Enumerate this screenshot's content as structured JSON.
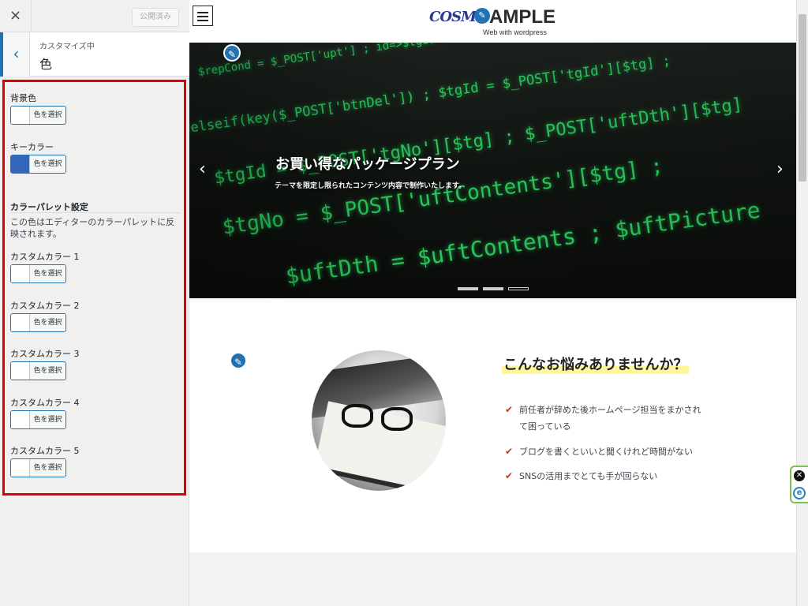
{
  "sidebar": {
    "close_icon": "×",
    "publish_label": "公開済み",
    "back_icon": "‹",
    "subtitle": "カスタマイズ中",
    "title": "色",
    "controls": [
      {
        "label": "背景色",
        "button": "色を選択",
        "color": "#ffffff"
      },
      {
        "label": "キーカラー",
        "button": "色を選択",
        "color": "#3366b8"
      }
    ],
    "palette_heading": "カラーパレット設定",
    "palette_desc": "この色はエディターのカラーパレットに反映されます。",
    "custom_colors": [
      {
        "label": "カスタムカラー 1",
        "button": "色を選択",
        "color": "#ffffff"
      },
      {
        "label": "カスタムカラー 2",
        "button": "色を選択",
        "color": "#ffffff"
      },
      {
        "label": "カスタムカラー 3",
        "button": "色を選択",
        "color": "#ffffff"
      },
      {
        "label": "カスタムカラー 4",
        "button": "色を選択",
        "color": "#ffffff"
      },
      {
        "label": "カスタムカラー 5",
        "button": "色を選択",
        "color": "#ffffff"
      }
    ]
  },
  "preview": {
    "logo_mark": "COSMO",
    "logo_title": "AMPLE",
    "logo_subtitle": "Web with wordpress",
    "hero": {
      "title": "お買い得なパッケージプラン",
      "subtitle": "テーマを限定し限られたコンテンツ内容で制作いたします。",
      "prev_icon": "‹",
      "next_icon": "›"
    },
    "section": {
      "heading": "こんなお悩みありませんか？",
      "check_icon": "✔",
      "items": [
        "前任者が辞めた後ホームページ担当をまかされて困っている",
        "ブログを書くといいと聞くけれど時間がない",
        "SNSの活用までとても手が回らない"
      ]
    },
    "edit_icon": "✎",
    "widget_close": "✕",
    "widget_logo": "e"
  },
  "colors": {
    "accent": "#2271b1",
    "highlight_border": "#e00000",
    "key_color": "#3366b8"
  }
}
